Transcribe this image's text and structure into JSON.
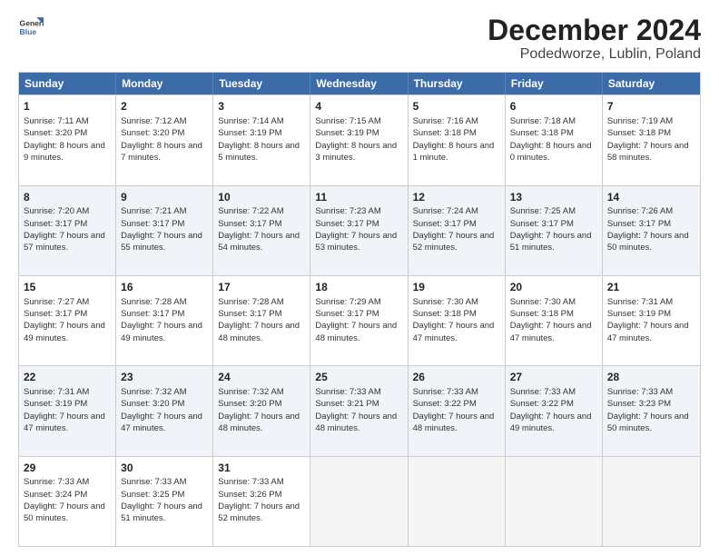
{
  "header": {
    "logo_line1": "General",
    "logo_line2": "Blue",
    "title": "December 2024",
    "subtitle": "Podedworze, Lublin, Poland"
  },
  "days_of_week": [
    "Sunday",
    "Monday",
    "Tuesday",
    "Wednesday",
    "Thursday",
    "Friday",
    "Saturday"
  ],
  "rows": [
    [
      {
        "day": "1",
        "sunrise": "Sunrise: 7:11 AM",
        "sunset": "Sunset: 3:20 PM",
        "daylight": "Daylight: 8 hours and 9 minutes."
      },
      {
        "day": "2",
        "sunrise": "Sunrise: 7:12 AM",
        "sunset": "Sunset: 3:20 PM",
        "daylight": "Daylight: 8 hours and 7 minutes."
      },
      {
        "day": "3",
        "sunrise": "Sunrise: 7:14 AM",
        "sunset": "Sunset: 3:19 PM",
        "daylight": "Daylight: 8 hours and 5 minutes."
      },
      {
        "day": "4",
        "sunrise": "Sunrise: 7:15 AM",
        "sunset": "Sunset: 3:19 PM",
        "daylight": "Daylight: 8 hours and 3 minutes."
      },
      {
        "day": "5",
        "sunrise": "Sunrise: 7:16 AM",
        "sunset": "Sunset: 3:18 PM",
        "daylight": "Daylight: 8 hours and 1 minute."
      },
      {
        "day": "6",
        "sunrise": "Sunrise: 7:18 AM",
        "sunset": "Sunset: 3:18 PM",
        "daylight": "Daylight: 8 hours and 0 minutes."
      },
      {
        "day": "7",
        "sunrise": "Sunrise: 7:19 AM",
        "sunset": "Sunset: 3:18 PM",
        "daylight": "Daylight: 7 hours and 58 minutes."
      }
    ],
    [
      {
        "day": "8",
        "sunrise": "Sunrise: 7:20 AM",
        "sunset": "Sunset: 3:17 PM",
        "daylight": "Daylight: 7 hours and 57 minutes."
      },
      {
        "day": "9",
        "sunrise": "Sunrise: 7:21 AM",
        "sunset": "Sunset: 3:17 PM",
        "daylight": "Daylight: 7 hours and 55 minutes."
      },
      {
        "day": "10",
        "sunrise": "Sunrise: 7:22 AM",
        "sunset": "Sunset: 3:17 PM",
        "daylight": "Daylight: 7 hours and 54 minutes."
      },
      {
        "day": "11",
        "sunrise": "Sunrise: 7:23 AM",
        "sunset": "Sunset: 3:17 PM",
        "daylight": "Daylight: 7 hours and 53 minutes."
      },
      {
        "day": "12",
        "sunrise": "Sunrise: 7:24 AM",
        "sunset": "Sunset: 3:17 PM",
        "daylight": "Daylight: 7 hours and 52 minutes."
      },
      {
        "day": "13",
        "sunrise": "Sunrise: 7:25 AM",
        "sunset": "Sunset: 3:17 PM",
        "daylight": "Daylight: 7 hours and 51 minutes."
      },
      {
        "day": "14",
        "sunrise": "Sunrise: 7:26 AM",
        "sunset": "Sunset: 3:17 PM",
        "daylight": "Daylight: 7 hours and 50 minutes."
      }
    ],
    [
      {
        "day": "15",
        "sunrise": "Sunrise: 7:27 AM",
        "sunset": "Sunset: 3:17 PM",
        "daylight": "Daylight: 7 hours and 49 minutes."
      },
      {
        "day": "16",
        "sunrise": "Sunrise: 7:28 AM",
        "sunset": "Sunset: 3:17 PM",
        "daylight": "Daylight: 7 hours and 49 minutes."
      },
      {
        "day": "17",
        "sunrise": "Sunrise: 7:28 AM",
        "sunset": "Sunset: 3:17 PM",
        "daylight": "Daylight: 7 hours and 48 minutes."
      },
      {
        "day": "18",
        "sunrise": "Sunrise: 7:29 AM",
        "sunset": "Sunset: 3:17 PM",
        "daylight": "Daylight: 7 hours and 48 minutes."
      },
      {
        "day": "19",
        "sunrise": "Sunrise: 7:30 AM",
        "sunset": "Sunset: 3:18 PM",
        "daylight": "Daylight: 7 hours and 47 minutes."
      },
      {
        "day": "20",
        "sunrise": "Sunrise: 7:30 AM",
        "sunset": "Sunset: 3:18 PM",
        "daylight": "Daylight: 7 hours and 47 minutes."
      },
      {
        "day": "21",
        "sunrise": "Sunrise: 7:31 AM",
        "sunset": "Sunset: 3:19 PM",
        "daylight": "Daylight: 7 hours and 47 minutes."
      }
    ],
    [
      {
        "day": "22",
        "sunrise": "Sunrise: 7:31 AM",
        "sunset": "Sunset: 3:19 PM",
        "daylight": "Daylight: 7 hours and 47 minutes."
      },
      {
        "day": "23",
        "sunrise": "Sunrise: 7:32 AM",
        "sunset": "Sunset: 3:20 PM",
        "daylight": "Daylight: 7 hours and 47 minutes."
      },
      {
        "day": "24",
        "sunrise": "Sunrise: 7:32 AM",
        "sunset": "Sunset: 3:20 PM",
        "daylight": "Daylight: 7 hours and 48 minutes."
      },
      {
        "day": "25",
        "sunrise": "Sunrise: 7:33 AM",
        "sunset": "Sunset: 3:21 PM",
        "daylight": "Daylight: 7 hours and 48 minutes."
      },
      {
        "day": "26",
        "sunrise": "Sunrise: 7:33 AM",
        "sunset": "Sunset: 3:22 PM",
        "daylight": "Daylight: 7 hours and 48 minutes."
      },
      {
        "day": "27",
        "sunrise": "Sunrise: 7:33 AM",
        "sunset": "Sunset: 3:22 PM",
        "daylight": "Daylight: 7 hours and 49 minutes."
      },
      {
        "day": "28",
        "sunrise": "Sunrise: 7:33 AM",
        "sunset": "Sunset: 3:23 PM",
        "daylight": "Daylight: 7 hours and 50 minutes."
      }
    ],
    [
      {
        "day": "29",
        "sunrise": "Sunrise: 7:33 AM",
        "sunset": "Sunset: 3:24 PM",
        "daylight": "Daylight: 7 hours and 50 minutes."
      },
      {
        "day": "30",
        "sunrise": "Sunrise: 7:33 AM",
        "sunset": "Sunset: 3:25 PM",
        "daylight": "Daylight: 7 hours and 51 minutes."
      },
      {
        "day": "31",
        "sunrise": "Sunrise: 7:33 AM",
        "sunset": "Sunset: 3:26 PM",
        "daylight": "Daylight: 7 hours and 52 minutes."
      },
      null,
      null,
      null,
      null
    ]
  ]
}
